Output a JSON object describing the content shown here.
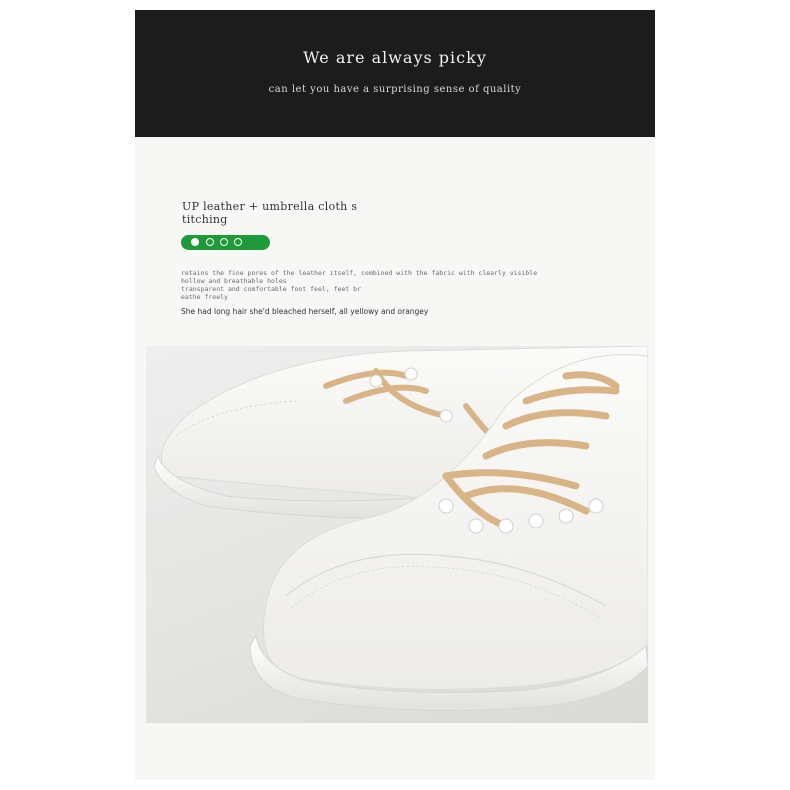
{
  "banner": {
    "title": "We are always picky",
    "subtitle": "can let you have a surprising sense of quality"
  },
  "feature": {
    "title_line1": "UP leather + umbrella cloth s",
    "title_line2": "titching",
    "pager": {
      "count": 4,
      "active_index": 0,
      "color": "#1e9a3a"
    },
    "description_lines": [
      "retains the fine pores of the leather itself, combined with the fabric with clearly visible",
      "hollow and breathable holes",
      "transparent and comfortable foot feel, feet br",
      "eathe freely"
    ],
    "extra_line": "She had long hair she'd bleached herself, all yellowy and orangey"
  },
  "photo": {
    "subject": "pair of white sneakers with tan laces",
    "lace_color": "#d8b487",
    "shoe_color": "#f6f6f4"
  }
}
